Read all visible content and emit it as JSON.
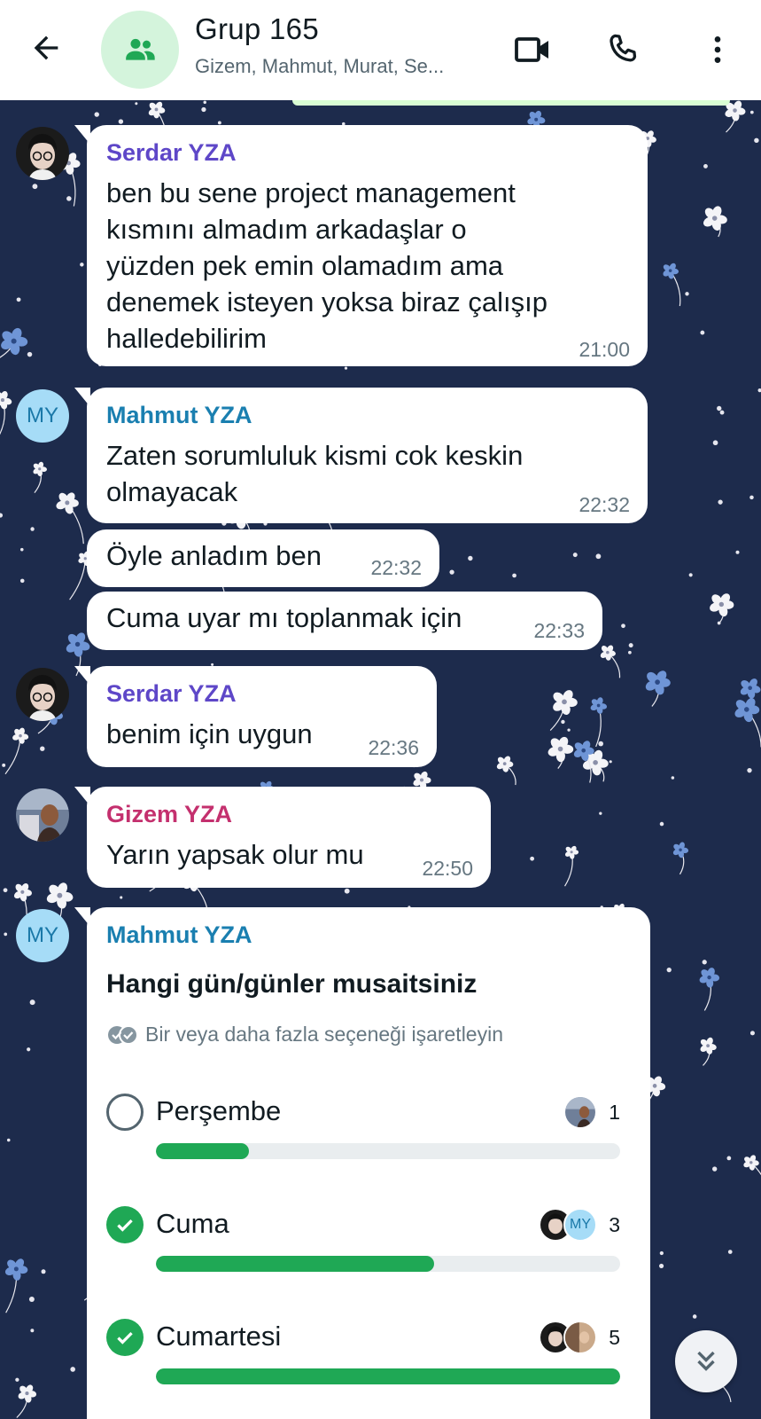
{
  "header": {
    "title": "Grup 165",
    "members": "Gizem, Mahmut, Murat, Se..."
  },
  "colors": {
    "serdar": "#5e47c8",
    "mahmut": "#1a7fb0",
    "gizem": "#c4306e",
    "poll_green": "#1fa855"
  },
  "avatars": {
    "my_initials": "MY"
  },
  "messages": [
    {
      "sender": "Serdar YZA",
      "lines": [
        "ben bu sene project management",
        "kısmını almadım arkadaşlar o",
        "yüzden pek emin olamadım ama",
        "denemek isteyen yoksa biraz çalışıp",
        "halledebilirim"
      ],
      "time": "21:00"
    },
    {
      "sender": "Mahmut YZA",
      "lines": [
        "Zaten sorumluluk kismi cok keskin",
        "olmayacak"
      ],
      "time": "22:32"
    },
    {
      "text": "Öyle anladım ben",
      "time": "22:32"
    },
    {
      "text": "Cuma uyar mı toplanmak için",
      "time": "22:33"
    },
    {
      "sender": "Serdar YZA",
      "text": "benim için uygun",
      "time": "22:36"
    },
    {
      "sender": "Gizem YZA",
      "text": "Yarın yapsak olur mu",
      "time": "22:50"
    }
  ],
  "poll": {
    "sender": "Mahmut YZA",
    "question": "Hangi gün/günler musaitsiniz",
    "hint": "Bir veya daha fazla seçeneği işaretleyin",
    "options": [
      {
        "label": "Perşembe",
        "votes": "1",
        "fraction": 0.2,
        "checked": false
      },
      {
        "label": "Cuma",
        "votes": "3",
        "fraction": 0.6,
        "checked": true
      },
      {
        "label": "Cumartesi",
        "votes": "5",
        "fraction": 1.0,
        "checked": true
      }
    ]
  },
  "icons": {
    "back": "arrow-left-icon",
    "group": "group-icon",
    "video": "video-call-icon",
    "call": "phone-icon",
    "menu": "more-vertical-icon",
    "scroll": "double-chevron-down-icon"
  }
}
